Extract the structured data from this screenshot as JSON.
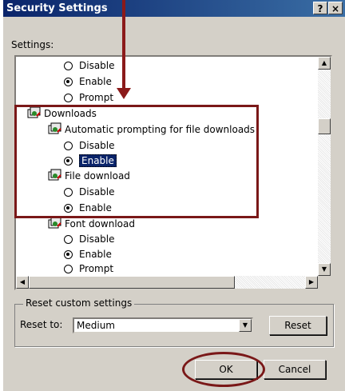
{
  "window": {
    "title": "Security Settings",
    "help_label": "?",
    "close_label": "×"
  },
  "settings_label": "Settings:",
  "tree_items": [
    {
      "type": "radio",
      "label": "Disable",
      "selected": false
    },
    {
      "type": "radio",
      "label": "Enable",
      "selected": true
    },
    {
      "type": "radio",
      "label": "Prompt",
      "selected": false
    },
    {
      "type": "category",
      "label": "Downloads"
    },
    {
      "type": "setting",
      "label": "Automatic prompting for file downloads"
    },
    {
      "type": "radio",
      "label": "Disable",
      "selected": false
    },
    {
      "type": "radio",
      "label": "Enable",
      "selected": true
    },
    {
      "type": "setting",
      "label": "File download"
    },
    {
      "type": "radio",
      "label": "Disable",
      "selected": false
    },
    {
      "type": "radio",
      "label": "Enable",
      "selected": true
    },
    {
      "type": "setting",
      "label": "Font download"
    },
    {
      "type": "radio",
      "label": "Disable",
      "selected": false
    },
    {
      "type": "radio",
      "label": "Enable",
      "selected": true
    },
    {
      "type": "radio",
      "label": "Prompt",
      "selected": false
    }
  ],
  "reset_group": {
    "legend": "Reset custom settings",
    "reset_to_label": "Reset to:",
    "selected_level": "Medium",
    "reset_button": "Reset"
  },
  "buttons": {
    "ok": "OK",
    "cancel": "Cancel"
  },
  "colors": {
    "annotation": "#7a1818",
    "selection": "#0a246a",
    "titlebar": "#0a246a",
    "dialog_bg": "#d4d0c8"
  }
}
